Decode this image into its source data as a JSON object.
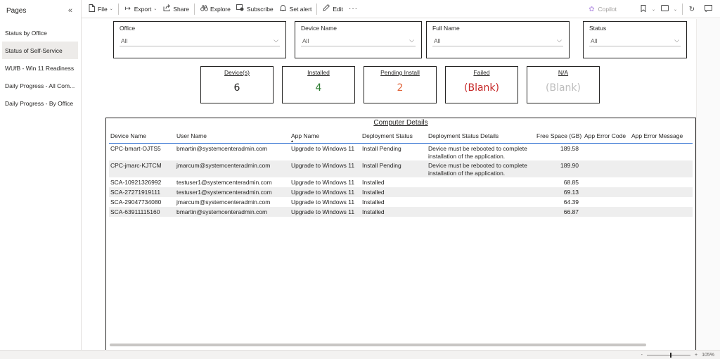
{
  "sidebar": {
    "title": "Pages",
    "collapse_icon": "«",
    "items": [
      {
        "label": "Status by Office"
      },
      {
        "label": "Status of Self-Service"
      },
      {
        "label": "WUfB - Win 11 Readiness"
      },
      {
        "label": "Daily Progress - All Com..."
      },
      {
        "label": "Daily Progress - By Office"
      }
    ],
    "active_index": 1
  },
  "toolbar": {
    "file": "File",
    "export": "Export",
    "share": "Share",
    "explore": "Explore",
    "subscribe": "Subscribe",
    "set_alert": "Set alert",
    "edit": "Edit",
    "more": "···",
    "copilot": "Copilot"
  },
  "slicers": [
    {
      "title": "Office",
      "value": "All"
    },
    {
      "title": "Device Name",
      "value": "All"
    },
    {
      "title": "Full Name",
      "value": "All"
    },
    {
      "title": "Status",
      "value": "All"
    }
  ],
  "kpis": [
    {
      "label": "Device(s)",
      "value": "6",
      "color": "#252423"
    },
    {
      "label": "Installed",
      "value": "4",
      "color": "#2e7d32"
    },
    {
      "label": "Pending Install",
      "value": "2",
      "color": "#e0653a"
    },
    {
      "label": "Failed",
      "value": "(Blank)",
      "color": "#c62828"
    },
    {
      "label": "N/A",
      "value": "(Blank)",
      "color": "#bdbdbd"
    }
  ],
  "table": {
    "title": "Computer Details",
    "columns": [
      "Device Name",
      "User Name",
      "App Name",
      "Deployment Status",
      "Deployment Status Details",
      "Free Space (GB)",
      "App Error Code",
      "App Error Message"
    ],
    "sort_column": "App Name",
    "rows": [
      [
        "CPC-bmart-OJTS5",
        "bmartin@systemcenteradmin.com",
        "Upgrade to Windows 11",
        "Install Pending",
        "Device must be rebooted to complete installation of the application.",
        "189.58",
        "",
        ""
      ],
      [
        "CPC-jmarc-KJTCM",
        "jmarcum@systemcenteradmin.com",
        "Upgrade to Windows 11",
        "Install Pending",
        "Device must be rebooted to complete installation of the application.",
        "189.90",
        "",
        ""
      ],
      [
        "SCA-10921326992",
        "testuser1@systemcenteradmin.com",
        "Upgrade to Windows 11",
        "Installed",
        "",
        "68.85",
        "",
        ""
      ],
      [
        "SCA-27271919111",
        "testuser1@systemcenteradmin.com",
        "Upgrade to Windows 11",
        "Installed",
        "",
        "69.13",
        "",
        ""
      ],
      [
        "SCA-29047734080",
        "jmarcum@systemcenteradmin.com",
        "Upgrade to Windows 11",
        "Installed",
        "",
        "64.39",
        "",
        ""
      ],
      [
        "SCA-63911115160",
        "bmartin@systemcenteradmin.com",
        "Upgrade to Windows 11",
        "Installed",
        "",
        "66.87",
        "",
        ""
      ]
    ]
  },
  "statusbar": {
    "zoom_minus": "-",
    "zoom_plus": "+",
    "zoom_level": "105%"
  }
}
